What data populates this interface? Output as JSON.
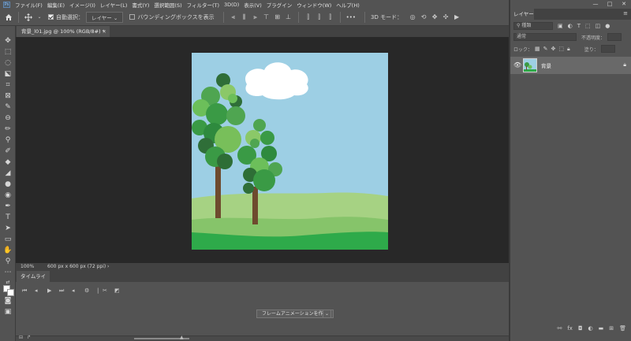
{
  "menubar": {
    "logo": "Ps",
    "items": [
      "ファイル(F)",
      "編集(E)",
      "イメージ(I)",
      "レイヤー(L)",
      "書式(Y)",
      "選択範囲(S)",
      "フィルター(T)",
      "3D(D)",
      "表示(V)",
      "プラグイン",
      "ウィンドウ(W)",
      "ヘルプ(H)"
    ],
    "window_controls": [
      "—",
      "□",
      "✕"
    ]
  },
  "optionsbar": {
    "auto_select_label": "自動選択：",
    "auto_select_checked": true,
    "target_select": "レイヤー",
    "bounding_box_label": "バウンディングボックスを表示",
    "bounding_box_checked": false,
    "more_label": "•••",
    "mode_3d_label": "3D モード："
  },
  "document": {
    "tab_title": "背景_l01.jpg @ 100% (RGB/8#) *",
    "close": "×"
  },
  "statusbar": {
    "zoom": "100%",
    "doc_info": "600 px x 600 px (72 ppi)",
    "arrow": "›"
  },
  "timeline": {
    "tab_label": "タイムライン",
    "create_button": "フレームアニメーションを作成",
    "dropdown": "⌄"
  },
  "layers": {
    "tab_label": "レイヤー",
    "search_placeholder": "種類",
    "blend_mode": "通常",
    "opacity_label": "不透明度：",
    "lock_label": "ロック：",
    "fill_label": "塗り：",
    "items": [
      {
        "name": "背景",
        "visible": true,
        "locked": true
      }
    ]
  },
  "colors": {
    "sky": "#9dcfe4",
    "ground_light": "#9fcd7e",
    "ground_mid": "#7fbe63",
    "ground_dark": "#2eaa4a",
    "trunk": "#6e4a2e"
  }
}
